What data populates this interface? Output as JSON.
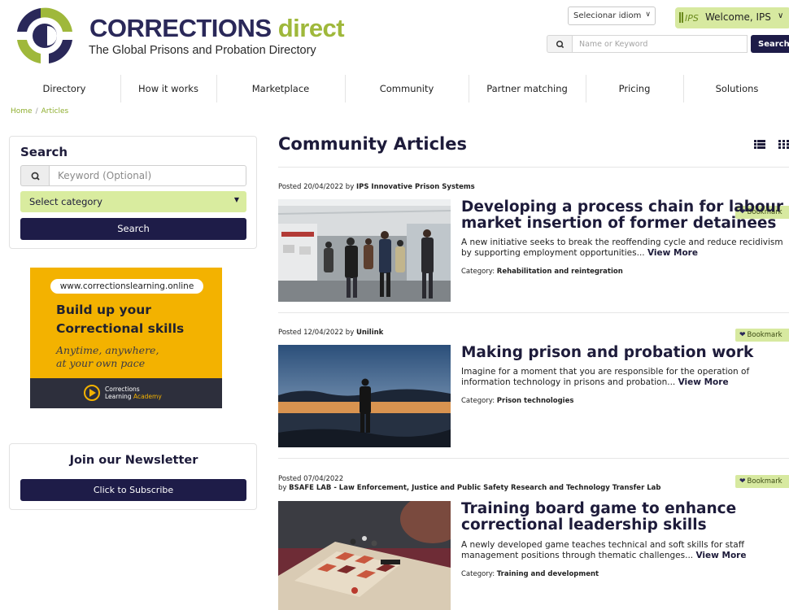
{
  "brand": {
    "name_part1": "CORRECTIONS",
    "name_part2": "direct",
    "tagline": "The Global Prisons and Probation Directory"
  },
  "header": {
    "language_select": "Selecionar idiom",
    "welcome_text": "Welcome, IPS",
    "ips_logo_text": "IPS",
    "search_placeholder": "Name or Keyword",
    "search_button": "Search"
  },
  "nav": {
    "items": [
      {
        "label": "Directory"
      },
      {
        "label": "How it works"
      },
      {
        "label": "Marketplace"
      },
      {
        "label": "Community"
      },
      {
        "label": "Partner matching"
      },
      {
        "label": "Pricing"
      },
      {
        "label": "Solutions"
      }
    ]
  },
  "breadcrumb": {
    "home": "Home",
    "separator": "/",
    "current": "Articles"
  },
  "sidebar": {
    "search_title": "Search",
    "keyword_placeholder": "Keyword (Optional)",
    "category_select": "Select category",
    "search_button": "Search",
    "ad": {
      "url": "www.correctionslearning.online",
      "headline_line1": "Build up your",
      "headline_line2": "Correctional skills",
      "tagline_line1": "Anytime, anywhere,",
      "tagline_line2": "at your own pace",
      "brand_line1": "Corrections",
      "brand_line2a": "Learning",
      "brand_line2b": "Academy"
    },
    "newsletter_title": "Join our Newsletter",
    "subscribe_button": "Click to Subscribe"
  },
  "main": {
    "title": "Community Articles",
    "bookmark_label": "Bookmark",
    "view_more": "View More",
    "category_prefix": "Category:",
    "articles": [
      {
        "posted": "Posted 20/04/2022 by",
        "author": "IPS Innovative Prison Systems",
        "title": "Developing a process chain for labour market insertion of former detainees",
        "excerpt": "A new initiative seeks to break the reoffending cycle and reduce recidivism by supporting employment opportunities...",
        "category": "Rehabilitation and reintegration"
      },
      {
        "posted": "Posted 12/04/2022 by",
        "author": "Unilink",
        "title": "Making prison and probation work",
        "excerpt": "Imagine for a moment that you are responsible for the operation of information technology in prisons and probation...",
        "category": "Prison technologies"
      },
      {
        "posted": "Posted 07/04/2022",
        "by": "by",
        "author": "BSAFE LAB - Law Enforcement, Justice and Public Safety Research and Technology Transfer Lab",
        "title": "Training board game to enhance correctional leadership skills",
        "excerpt": "A newly developed game teaches technical and soft skills for staff management positions through thematic challenges...",
        "category": "Training and development"
      }
    ]
  },
  "colors": {
    "navy": "#1e1c48",
    "lime": "#9fb83b",
    "lime_light": "#d7e9a0",
    "ad_yellow": "#f3b200"
  }
}
